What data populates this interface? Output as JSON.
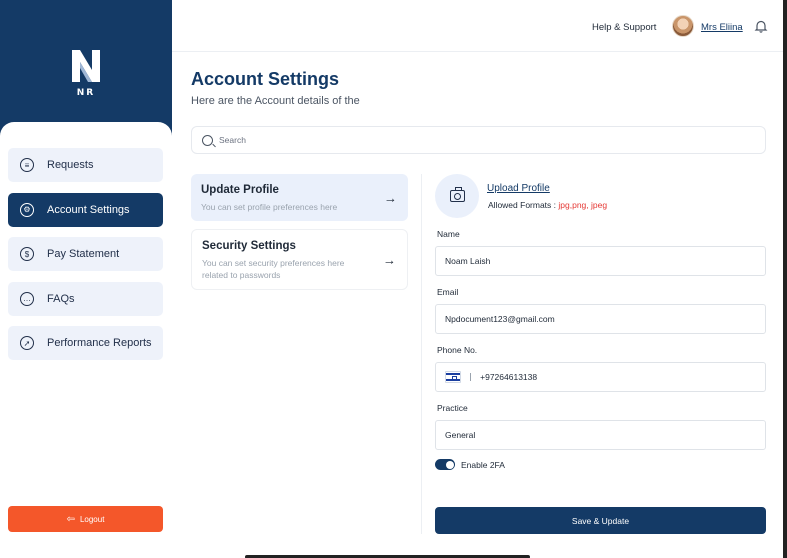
{
  "brand": {
    "logo_letter": "N",
    "logo_text": "NR"
  },
  "sidebar": {
    "items": [
      {
        "label": "Requests",
        "icon": "document-icon",
        "glyph": "≡"
      },
      {
        "label": "Account Settings",
        "icon": "gear-icon",
        "glyph": "⚙"
      },
      {
        "label": "Pay Statement",
        "icon": "dollar-icon",
        "glyph": "$"
      },
      {
        "label": "FAQs",
        "icon": "chat-icon",
        "glyph": "…"
      },
      {
        "label": "Performance Reports",
        "icon": "rocket-icon",
        "glyph": "➚"
      }
    ],
    "active_index": 1,
    "logout_label": "Logout"
  },
  "header": {
    "help_label": "Help & Support",
    "user_name": "Mrs Eliina"
  },
  "page": {
    "title": "Account Settings",
    "subtitle": "Here are the Account details of  the"
  },
  "search": {
    "placeholder": "Search"
  },
  "cards": [
    {
      "title": "Update Profile",
      "desc": "You can set profile preferences here"
    },
    {
      "title": "Security Settings",
      "desc": "You can set security preferences here related to passwords"
    }
  ],
  "profile": {
    "upload_label": "Upload Profile",
    "formats_label": "Allowed Formats : ",
    "formats_value": "jpg,png, jpeg"
  },
  "form": {
    "name_label": "Name",
    "name_value": "Noam Laish",
    "email_label": "Email",
    "email_value": "Npdocument123@gmail.com",
    "phone_label": "Phone No.",
    "phone_value": "+97264613138",
    "practice_label": "Practice",
    "practice_value": "General",
    "twofa_label": "Enable 2FA",
    "twofa_enabled": true,
    "save_label": "Save & Update"
  },
  "colors": {
    "primary": "#143a66",
    "accent": "#f4572a",
    "error": "#e53935"
  }
}
